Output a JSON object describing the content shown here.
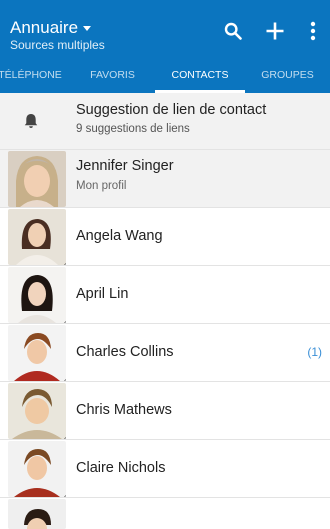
{
  "header": {
    "title": "Annuaire",
    "subtitle": "Sources multiples",
    "bg_color": "#0b75bf",
    "actions": [
      {
        "icon": "search-icon"
      },
      {
        "icon": "add-icon"
      },
      {
        "icon": "more-vertical-icon"
      }
    ]
  },
  "tabs": [
    {
      "label": "TÉLÉPHONE",
      "active": false
    },
    {
      "label": "FAVORIS",
      "active": false
    },
    {
      "label": "CONTACTS",
      "active": true
    },
    {
      "label": "GROUPES",
      "active": false
    }
  ],
  "suggestion": {
    "icon": "bell-icon",
    "title": "Suggestion de lien de contact",
    "subtitle": "9 suggestions de liens"
  },
  "profile": {
    "name": "Jennifer Singer",
    "subtitle": "Mon profil"
  },
  "contacts": [
    {
      "name": "Angela Wang"
    },
    {
      "name": "April Lin"
    },
    {
      "name": "Charles Collins",
      "count": "(1)"
    },
    {
      "name": "Chris Mathews"
    },
    {
      "name": "Claire Nichols"
    }
  ],
  "accent_color": "#3a8fd6"
}
